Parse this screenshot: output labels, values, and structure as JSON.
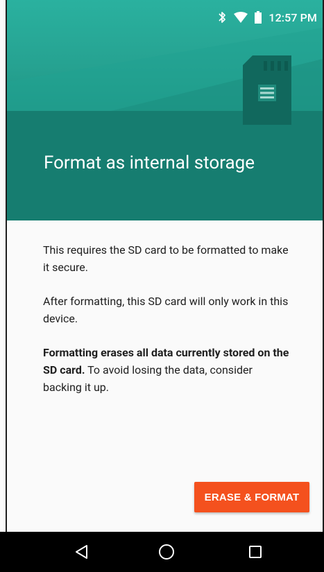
{
  "status_bar": {
    "time": "12:57 PM",
    "icons": [
      "bluetooth-icon",
      "wifi-icon",
      "battery-icon"
    ]
  },
  "header": {
    "title": "Format as internal storage",
    "illustration": "sd-card-icon"
  },
  "body": {
    "paragraph1": "This requires the SD card to be formatted to make it secure.",
    "paragraph2": "After formatting, this SD card will only work in this device.",
    "paragraph3_bold": "Formatting erases all data currently stored on the SD card.",
    "paragraph3_rest": " To avoid losing the data, consider backing it up."
  },
  "actions": {
    "erase_format_label": "ERASE & FORMAT"
  },
  "navbar": {
    "buttons": [
      "back-icon",
      "home-icon",
      "recents-icon"
    ]
  },
  "colors": {
    "header_dark": "#167d70",
    "header_light": "#2ab19f",
    "accent": "#f4511e",
    "background": "#fafafa"
  }
}
